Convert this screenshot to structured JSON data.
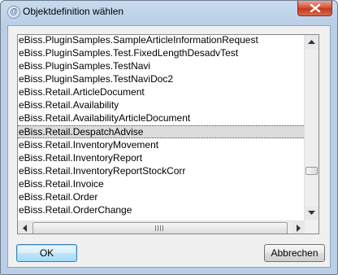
{
  "window": {
    "title": "Objektdefinition wählen",
    "app_icon": "@",
    "close_icon": "close-icon"
  },
  "list": {
    "items": [
      "eBiss.PluginSamples.SampleArticleInformationRequest",
      "eBiss.PluginSamples.Test.FixedLengthDesadvTest",
      "eBiss.PluginSamples.TestNavi",
      "eBiss.PluginSamples.TestNaviDoc2",
      "eBiss.Retail.ArticleDocument",
      "eBiss.Retail.Availability",
      "eBiss.Retail.AvailabilityArticleDocument",
      "eBiss.Retail.DespatchAdvise",
      "eBiss.Retail.InventoryMovement",
      "eBiss.Retail.InventoryReport",
      "eBiss.Retail.InventoryReportStockCorr",
      "eBiss.Retail.Invoice",
      "eBiss.Retail.Order",
      "eBiss.Retail.OrderChange"
    ],
    "selected_index": 7
  },
  "buttons": {
    "ok": "OK",
    "cancel": "Abbrechen"
  },
  "colors": {
    "title_bar": "#b9cfe7",
    "close_button": "#c23a1e",
    "selection": "#dcdcdc",
    "ok_button_border": "#3c7fb1"
  }
}
